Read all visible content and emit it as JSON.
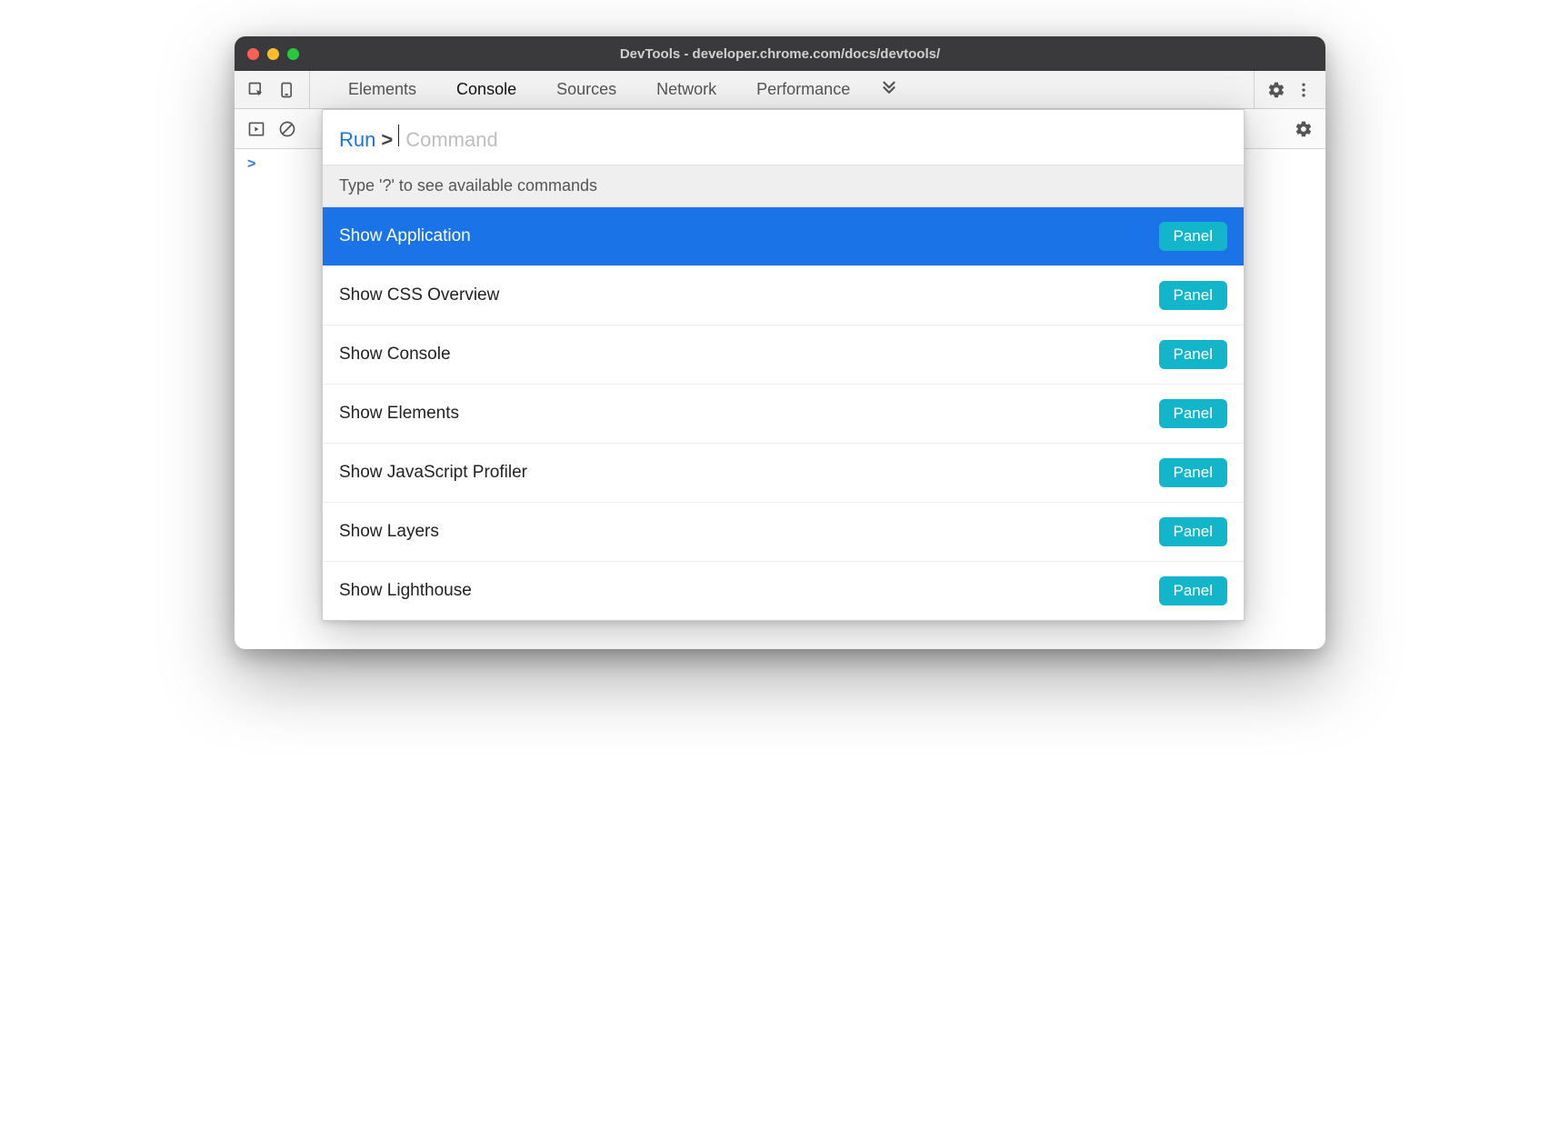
{
  "window": {
    "title": "DevTools - developer.chrome.com/docs/devtools/"
  },
  "tabs": {
    "items": [
      "Elements",
      "Console",
      "Sources",
      "Network",
      "Performance"
    ],
    "active_index": 1
  },
  "console": {
    "prompt_glyph": ">"
  },
  "command_menu": {
    "run_label": "Run",
    "gt": ">",
    "placeholder": "Command",
    "hint": "Type '?' to see available commands",
    "selected_index": 0,
    "items": [
      {
        "label": "Show Application",
        "badge": "Panel"
      },
      {
        "label": "Show CSS Overview",
        "badge": "Panel"
      },
      {
        "label": "Show Console",
        "badge": "Panel"
      },
      {
        "label": "Show Elements",
        "badge": "Panel"
      },
      {
        "label": "Show JavaScript Profiler",
        "badge": "Panel"
      },
      {
        "label": "Show Layers",
        "badge": "Panel"
      },
      {
        "label": "Show Lighthouse",
        "badge": "Panel"
      }
    ]
  }
}
